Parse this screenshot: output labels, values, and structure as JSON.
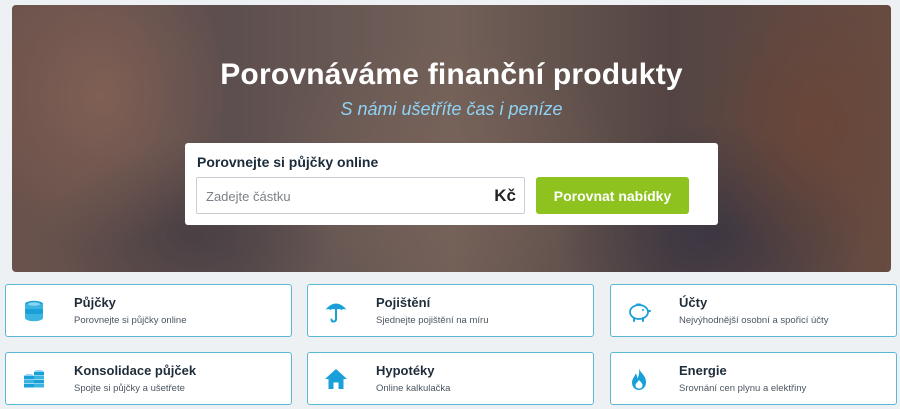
{
  "hero": {
    "title": "Porovnáváme finanční produkty",
    "subtitle": "S námi ušetříte čas i peníze"
  },
  "search": {
    "title": "Porovnejte si půjčky online",
    "placeholder": "Zadejte částku",
    "currency": "Kč",
    "button_label": "Porovnat nabídky"
  },
  "categories": [
    {
      "title": "Půjčky",
      "description": "Porovnejte si půjčky online",
      "icon": "coins-stack-icon"
    },
    {
      "title": "Pojištění",
      "description": "Sjednejte pojištění na míru",
      "icon": "umbrella-icon"
    },
    {
      "title": "Účty",
      "description": "Nejvýhodnější osobní a spořicí účty",
      "icon": "piggy-bank-icon"
    },
    {
      "title": "Konsolidace půjček",
      "description": "Spojte si půjčky a ušetřete",
      "icon": "coin-stacks-icon"
    },
    {
      "title": "Hypotéky",
      "description": "Online kalkulačka",
      "icon": "house-icon"
    },
    {
      "title": "Energie",
      "description": "Srovnání cen plynu a elektřiny",
      "icon": "flame-icon"
    }
  ],
  "colors": {
    "accent_green": "#8dc21f",
    "icon_blue": "#1aa0d8",
    "tile_border": "#5ab8d6",
    "subtitle_blue": "#8fd3f4"
  }
}
